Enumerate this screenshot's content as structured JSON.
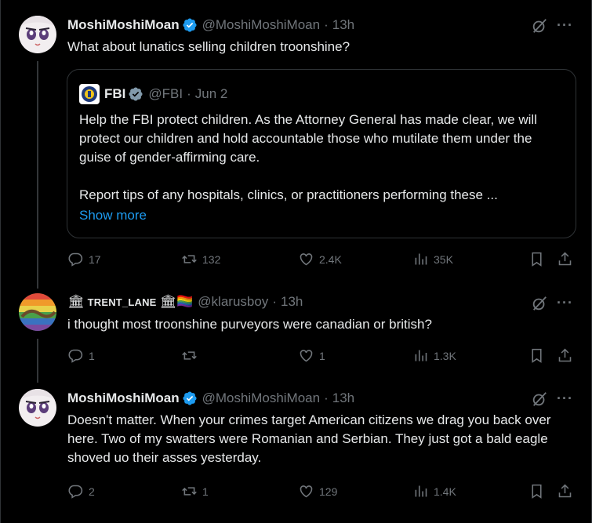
{
  "posts": [
    {
      "name": "MoshiMoshiMoan",
      "handle": "@MoshiMoshiMoan",
      "time": "13h",
      "text": "What about lunatics selling children troonshine?",
      "quote": {
        "name": "FBI",
        "handle": "@FBI",
        "time": "Jun 2",
        "text1": "Help the FBI protect children. As the Attorney General has made clear, we will protect our children and hold accountable those who mutilate them under the guise of gender-affirming care.",
        "text2": "Report tips of any hospitals, clinics, or practitioners performing these ...",
        "show_more": "Show more"
      },
      "replies": "17",
      "reposts": "132",
      "likes": "2.4K",
      "views": "35K"
    },
    {
      "name_prefix": "🏛",
      "name": "TRENT_LANE",
      "name_suffix": "🏛🏳️‍🌈",
      "handle": "@klarusboy",
      "time": "13h",
      "text": "i thought most troonshine purveyors were canadian or british?",
      "replies": "1",
      "reposts": "",
      "likes": "1",
      "views": "1.3K"
    },
    {
      "name": "MoshiMoshiMoan",
      "handle": "@MoshiMoshiMoan",
      "time": "13h",
      "text": "Doesn't matter.  When your crimes target American citizens we drag you back over here.  Two of my swatters were Romanian and Serbian.  They just got a bald eagle shoved uo their asses yesterday.",
      "replies": "2",
      "reposts": "1",
      "likes": "129",
      "views": "1.4K"
    }
  ],
  "separator_dot": "·",
  "more_glyph": "···",
  "colors": {
    "accent": "#1d9bf0",
    "muted": "#71767b",
    "text": "#e7e9ea",
    "border": "#2f3336"
  },
  "icons": [
    "verified-badge-icon",
    "grok-icon",
    "more-icon",
    "reply-icon",
    "repost-icon",
    "like-icon",
    "views-icon",
    "bookmark-icon",
    "share-icon"
  ]
}
